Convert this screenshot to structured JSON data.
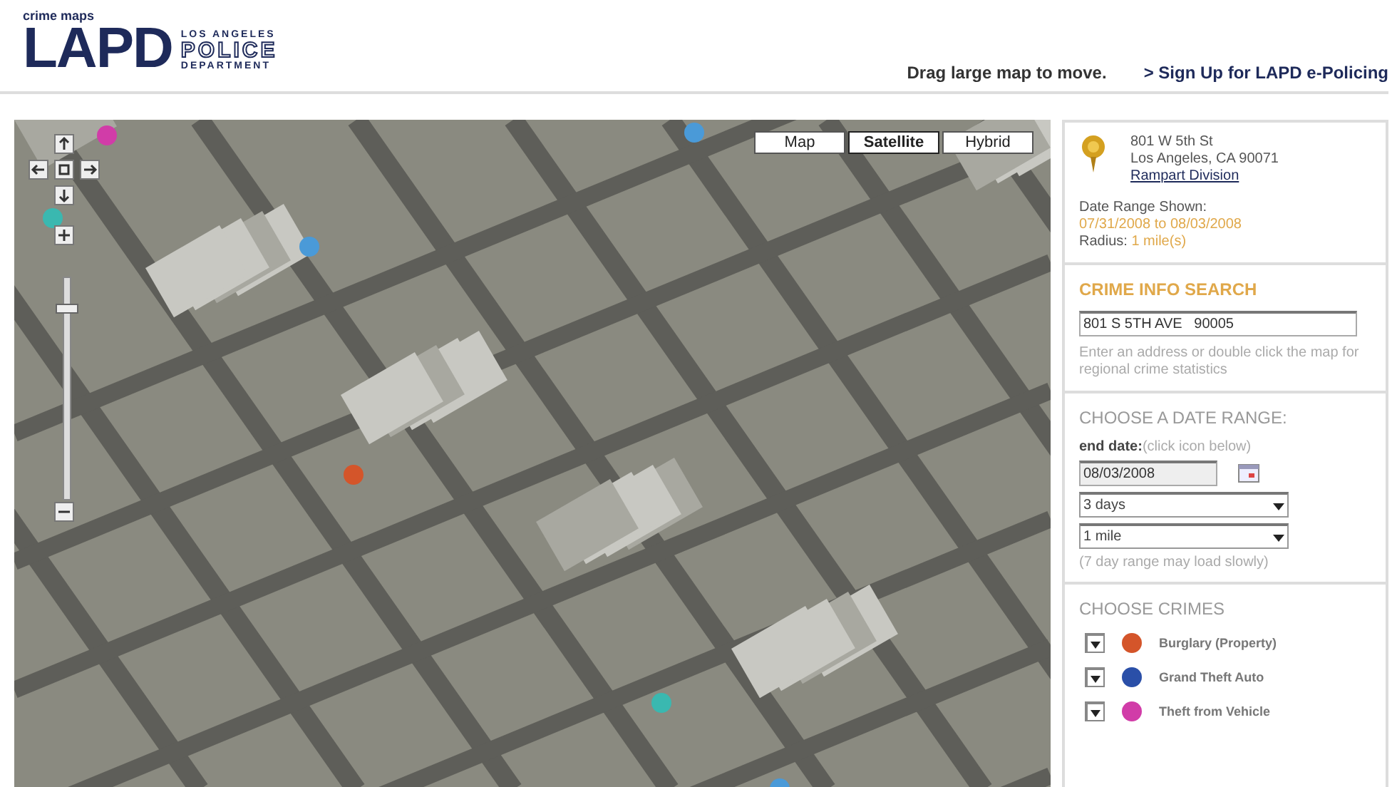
{
  "header": {
    "logo_small": "crime maps",
    "logo_main": "LAPD",
    "logo_line1": "LOS ANGELES",
    "logo_line2": "POLICE",
    "logo_line3": "DEPARTMENT",
    "hint": "Drag large map to move.",
    "signup_link": "> Sign Up for LAPD e-Policing"
  },
  "map": {
    "zoom": {
      "level": 0.88
    },
    "map_types": [
      {
        "label": "Map",
        "selected": false
      },
      {
        "label": "Satellite",
        "selected": true
      },
      {
        "label": "Hybrid",
        "selected": false
      }
    ]
  },
  "location": {
    "address_line1": "801 W 5th St",
    "address_line2": "Los Angeles, CA 90071",
    "division_link": "Rampart Division",
    "date_range_label": "Date Range Shown:",
    "date_range": "07/31/2008 to 08/03/2008",
    "radius_label": "Radius:",
    "radius": "1 mile(s)"
  },
  "search": {
    "title": "CRIME INFO SEARCH",
    "value": "801 S 5TH AVE   90005",
    "help": "Enter an address or double click the map for regional crime statistics"
  },
  "date_range": {
    "title": "CHOOSE A DATE RANGE:",
    "end_label": "end date:",
    "end_hint": "(click icon below)",
    "end_value": "08/03/2008",
    "period": "3 days",
    "radius": "1 mile",
    "note": "(7 day range may load slowly)"
  },
  "crimes": {
    "title": "CHOOSE CRIMES",
    "items": [
      {
        "label": "Burglary (Property)",
        "checked": true,
        "color": "#d4552a"
      },
      {
        "label": "Grand Theft Auto",
        "checked": true,
        "color": "#2a4fa8"
      },
      {
        "label": "Theft from Vehicle",
        "checked": true,
        "color": "#d13ca8"
      }
    ]
  }
}
